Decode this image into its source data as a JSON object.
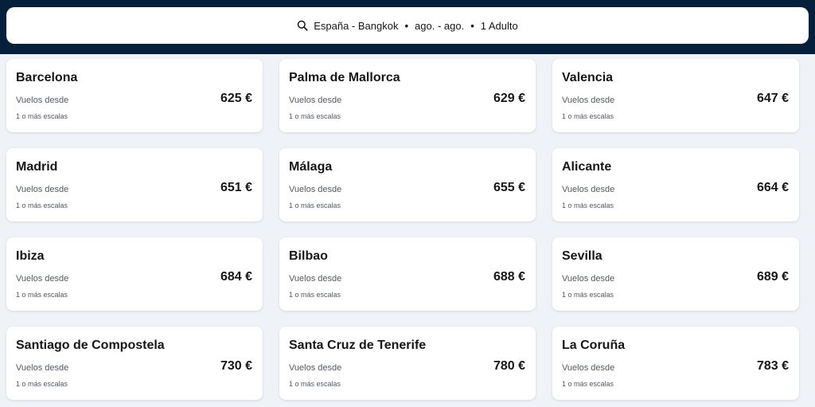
{
  "search": {
    "route": "España - Bangkok",
    "dates": "ago. - ago.",
    "passengers": "1 Adulto",
    "icon": "search-icon"
  },
  "colors": {
    "header_bg": "#05203c",
    "page_bg": "#eff3f8",
    "card_bg": "#ffffff",
    "text": "#161616",
    "muted": "#545860"
  },
  "destinations": [
    {
      "city": "Barcelona",
      "label": "Vuelos desde",
      "price": "625 €",
      "stops": "1 o más escalas"
    },
    {
      "city": "Palma de Mallorca",
      "label": "Vuelos desde",
      "price": "629 €",
      "stops": "1 o más escalas"
    },
    {
      "city": "Valencia",
      "label": "Vuelos desde",
      "price": "647 €",
      "stops": "1 o más escalas"
    },
    {
      "city": "Madrid",
      "label": "Vuelos desde",
      "price": "651 €",
      "stops": "1 o más escalas"
    },
    {
      "city": "Málaga",
      "label": "Vuelos desde",
      "price": "655 €",
      "stops": "1 o más escalas"
    },
    {
      "city": "Alicante",
      "label": "Vuelos desde",
      "price": "664 €",
      "stops": "1 o más escalas"
    },
    {
      "city": "Ibiza",
      "label": "Vuelos desde",
      "price": "684 €",
      "stops": "1 o más escalas"
    },
    {
      "city": "Bilbao",
      "label": "Vuelos desde",
      "price": "688 €",
      "stops": "1 o más escalas"
    },
    {
      "city": "Sevilla",
      "label": "Vuelos desde",
      "price": "689 €",
      "stops": "1 o más escalas"
    },
    {
      "city": "Santiago de Compostela",
      "label": "Vuelos desde",
      "price": "730 €",
      "stops": "1 o más escalas"
    },
    {
      "city": "Santa Cruz de Tenerife",
      "label": "Vuelos desde",
      "price": "780 €",
      "stops": "1 o más escalas"
    },
    {
      "city": "La Coruña",
      "label": "Vuelos desde",
      "price": "783 €",
      "stops": "1 o más escalas"
    }
  ]
}
